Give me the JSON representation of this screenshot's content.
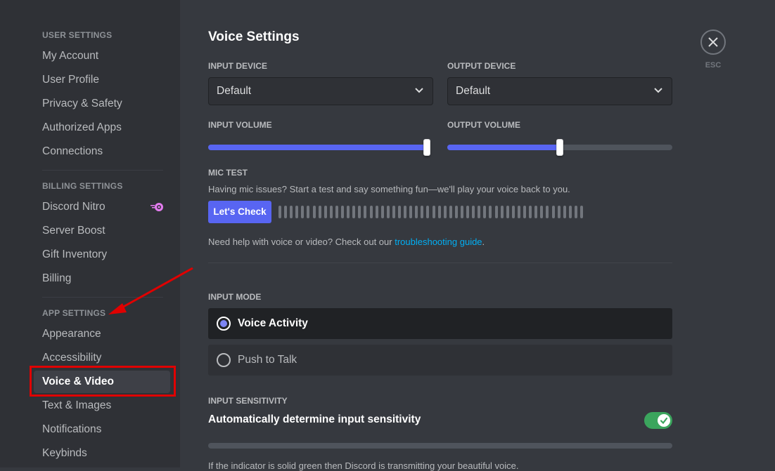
{
  "sidebar": {
    "sections": [
      {
        "header": "User Settings",
        "items": [
          "My Account",
          "User Profile",
          "Privacy & Safety",
          "Authorized Apps",
          "Connections"
        ]
      },
      {
        "header": "Billing Settings",
        "items": [
          "Discord Nitro",
          "Server Boost",
          "Gift Inventory",
          "Billing"
        ]
      },
      {
        "header": "App Settings",
        "items": [
          "Appearance",
          "Accessibility",
          "Voice & Video",
          "Text & Images",
          "Notifications",
          "Keybinds"
        ]
      }
    ],
    "active_item": "Voice & Video",
    "nitro_icon": "nitro-icon"
  },
  "main": {
    "title": "Voice Settings",
    "input_device": {
      "label": "Input Device",
      "value": "Default"
    },
    "output_device": {
      "label": "Output Device",
      "value": "Default"
    },
    "input_volume": {
      "label": "Input Volume",
      "percent": 100
    },
    "output_volume": {
      "label": "Output Volume",
      "percent": 50
    },
    "mic_test": {
      "label": "Mic Test",
      "description": "Having mic issues? Start a test and say something fun—we'll play your voice back to you.",
      "button": "Let's Check",
      "bar_count": 54
    },
    "help": {
      "prefix": "Need help with voice or video? Check out our ",
      "link": "troubleshooting guide",
      "suffix": "."
    },
    "input_mode": {
      "label": "Input Mode",
      "options": [
        {
          "label": "Voice Activity",
          "selected": true
        },
        {
          "label": "Push to Talk",
          "selected": false
        }
      ]
    },
    "input_sensitivity": {
      "label": "Input Sensitivity",
      "auto_label": "Automatically determine input sensitivity",
      "auto_enabled": true,
      "note": "If the indicator is solid green then Discord is transmitting your beautiful voice."
    }
  },
  "close": {
    "label": "ESC"
  },
  "colors": {
    "accent": "#5865f2",
    "toggle_on": "#3ba55d",
    "link": "#00aff4",
    "annotation": "#e00000"
  }
}
